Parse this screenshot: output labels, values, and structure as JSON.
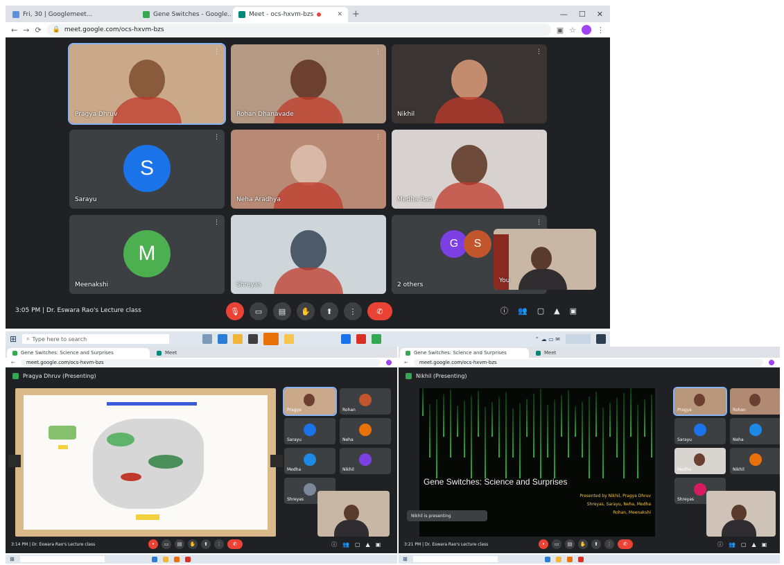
{
  "top": {
    "tabs": [
      {
        "label": "Fri, 30 | Googlemeet...",
        "favicon": "#5f8fd6",
        "active": false
      },
      {
        "label": "Gene Switches - Google...",
        "favicon": "#34a853",
        "active": false
      },
      {
        "label": "Meet - ocs-hxvm-bzs",
        "favicon": "#00897b",
        "active": true
      }
    ],
    "url": "meet.google.com/ocs-hxvm-bzs",
    "tiles": [
      {
        "name": "Pragya Dhruv",
        "type": "video",
        "bg": "#caa98a",
        "face": "#8a5a3c"
      },
      {
        "name": "Rohan Dhanavade",
        "type": "video",
        "bg": "#b49a84",
        "face": "#6b4030"
      },
      {
        "name": "Nikhil",
        "type": "video",
        "bg": "#3a3432",
        "face": "#c48c6e"
      },
      {
        "name": "Sarayu",
        "type": "avatar",
        "letter": "S",
        "color": "#1a73e8"
      },
      {
        "name": "Neha Aradhya",
        "type": "video",
        "bg": "#b88a75",
        "face": "#d8b9a8"
      },
      {
        "name": "Medha Rao",
        "type": "video",
        "bg": "#d7d2cf",
        "face": "#6e4a3a"
      },
      {
        "name": "Meenakshi",
        "type": "avatar",
        "letter": "M",
        "color": "#4caf50"
      },
      {
        "name": "Shreyas",
        "type": "video",
        "bg": "#cfd6da",
        "face": "#4d5a6a"
      },
      {
        "name": "2 others",
        "type": "others",
        "letters": [
          "G",
          "S"
        ],
        "colors": [
          "#7b3fe4",
          "#c2552c"
        ]
      }
    ],
    "self_view_label": "You",
    "bottom_left": "3:05 PM | Dr. Eswara Rao's Lecture class",
    "controls": [
      "mic-off-icon",
      "camera-icon",
      "captions-icon",
      "raise-hand-icon",
      "present-icon",
      "more-icon"
    ],
    "right_controls": [
      "info-icon",
      "people-icon",
      "chat-icon",
      "activities-icon",
      "lock-icon"
    ],
    "taskbar_search": "Type here to search"
  },
  "left": {
    "tabs": [
      "Gene Switches: Science and Surprises",
      "Meet"
    ],
    "url": "meet.google.com/ocs-hxvm-bzs",
    "presenter_label": "Pragya Dhruv (Presenting)",
    "bottom_left": "3:14 PM | Dr. Eswara Rao's Lecture class",
    "thumbs": [
      {
        "name": "Pragya",
        "color": "#caa98a",
        "type": "video"
      },
      {
        "name": "Rohan",
        "color": "#c2552c",
        "type": "avatar"
      },
      {
        "name": "Sarayu",
        "color": "#1a73e8",
        "type": "avatar"
      },
      {
        "name": "Neha",
        "color": "#e8710a",
        "type": "avatar"
      },
      {
        "name": "Medha",
        "color": "#1e88e5",
        "type": "avatar"
      },
      {
        "name": "Nikhil",
        "color": "#7b3fe4",
        "type": "avatar"
      },
      {
        "name": "Shreyas",
        "color": "#7a8899",
        "type": "avatar"
      }
    ]
  },
  "right": {
    "tabs": [
      "Gene Switches: Science and Surprises",
      "Meet"
    ],
    "url": "meet.google.com/ocs-hxvm-bzs",
    "presenter_label": "Nikhil (Presenting)",
    "slide_title": "Gene Switches: Science and Surprises",
    "slide_lines": [
      "Presented by Nikhil, Pragya Dhruv",
      "Shreyas, Sarayu, Neha, Medha",
      "Rohan, Meenakshi"
    ],
    "pin_label": "Nikhil is presenting",
    "bottom_left": "3:21 PM | Dr. Eswara Rao's Lecture class",
    "thumbs": [
      {
        "name": "Pragya",
        "color": "#b8977a",
        "type": "video"
      },
      {
        "name": "Rohan",
        "color": "#b08a73",
        "type": "video"
      },
      {
        "name": "Sarayu",
        "color": "#1a73e8",
        "type": "avatar"
      },
      {
        "name": "Neha",
        "color": "#1e88e5",
        "type": "avatar"
      },
      {
        "name": "Medha",
        "color": "#d8d4d0",
        "type": "video"
      },
      {
        "name": "Nikhil",
        "color": "#e8710a",
        "type": "avatar"
      },
      {
        "name": "Shreyas",
        "color": "#d81b60",
        "type": "avatar"
      }
    ]
  }
}
